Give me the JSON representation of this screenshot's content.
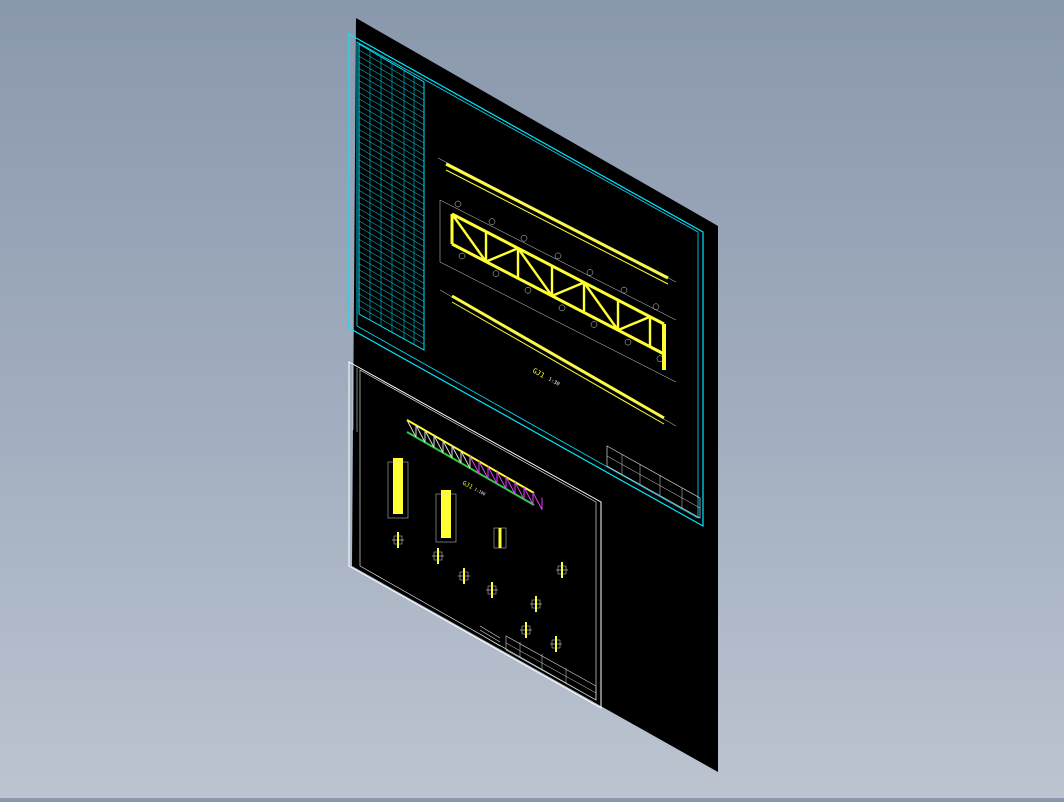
{
  "viewport": {
    "background_top": "#8a98ad",
    "background_bottom": "#bcc4d0",
    "projection": "isometric"
  },
  "colors": {
    "sheet": "#000000",
    "sheet1_frame": "#00e5ff",
    "sheet2_frame": "#ffffff",
    "truss": "#ffff33",
    "truss_alt": "#e040fb",
    "dims": "#d8d8d8",
    "table_lines": "#00e5ff"
  },
  "sheet1": {
    "view_caption": "GJ1",
    "scale_note": "1:30"
  },
  "sheet2": {
    "view_caption": "GJ1",
    "scale_note": "1:100"
  }
}
